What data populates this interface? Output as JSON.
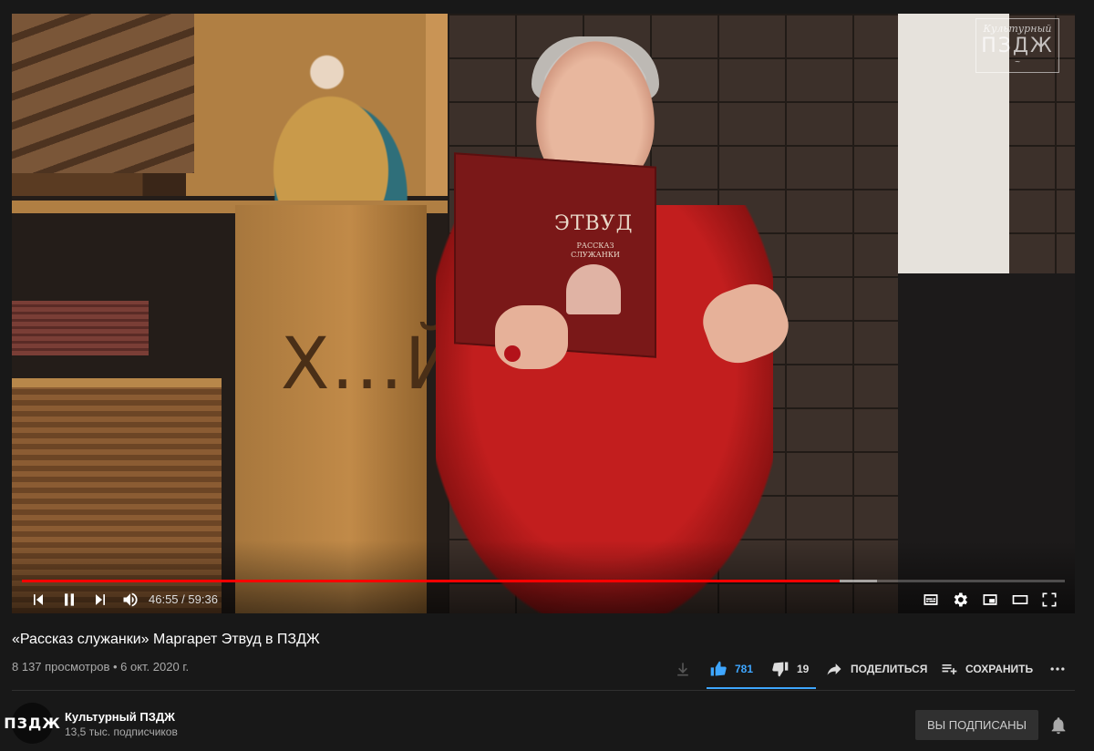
{
  "player": {
    "watermark": {
      "top": "Культурный",
      "main": "ПЗДЖ",
      "squiggle": "~"
    },
    "book": {
      "title": "ЭТВУД",
      "subtitle": "РАССКАЗ СЛУЖАНКИ"
    },
    "cabinet_text": "Х...Й",
    "progress": {
      "played_fraction": 0.7845,
      "buffered_fraction": 0.82
    },
    "time": {
      "current": "46:55",
      "separator": " / ",
      "duration": "59:36"
    }
  },
  "video": {
    "title": "«Рассказ служанки» Маргарет Этвуд в ПЗДЖ",
    "views": "8 137 просмотров",
    "dot": " • ",
    "date": "6 окт. 2020 г."
  },
  "actions": {
    "likes": "781",
    "dislikes": "19",
    "share_label": "ПОДЕЛИТЬСЯ",
    "save_label": "СОХРАНИТЬ"
  },
  "channel": {
    "avatar_text": "ПЗДЖ",
    "name": "Культурный ПЗДЖ",
    "subscribers": "13,5 тыс. подписчиков",
    "subscribe_label": "ВЫ ПОДПИСАНЫ"
  },
  "colors": {
    "accent": "#3ea6ff",
    "progress": "#ff0000",
    "background": "#181818"
  }
}
